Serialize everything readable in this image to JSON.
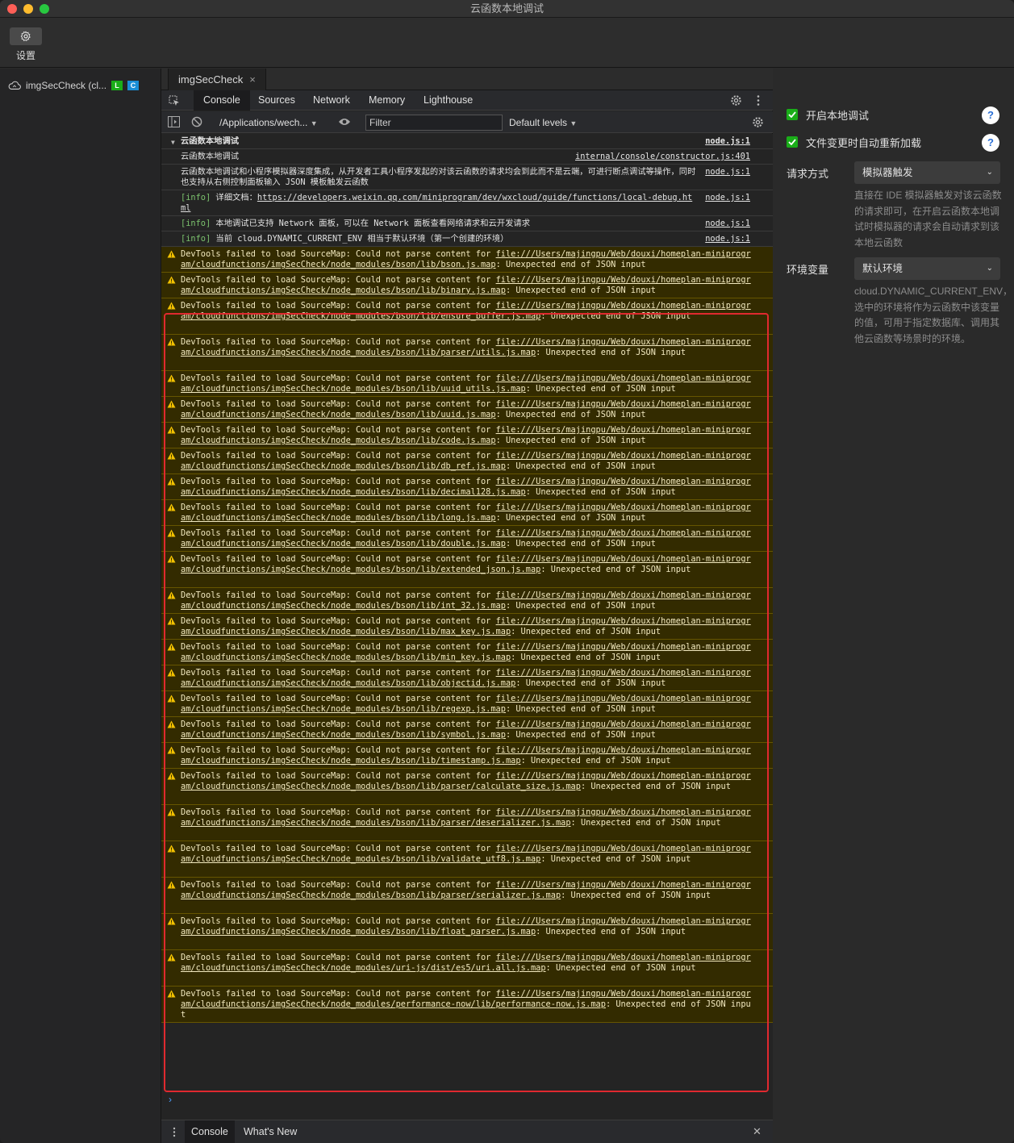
{
  "window": {
    "title": "云函数本地调试"
  },
  "toolbar": {
    "settings_label": "设置"
  },
  "sidebar": {
    "function_name": "imgSecCheck (cl...",
    "badge_l": "L",
    "badge_c": "C"
  },
  "file_tab": {
    "label": "imgSecCheck",
    "close": "×"
  },
  "devtools": {
    "tabs": [
      "Console",
      "Sources",
      "Network",
      "Memory",
      "Lighthouse"
    ],
    "context": "/Applications/wech...",
    "filter_placeholder": "Filter",
    "levels": "Default levels"
  },
  "console": {
    "group_title": "云函数本地调试",
    "group_src": "node.js:1",
    "messages": [
      {
        "text": "云函数本地调试",
        "src": "internal/console/constructor.js:401"
      },
      {
        "text": "云函数本地调试和小程序模拟器深度集成，从开发者工具小程序发起的对该云函数的请求均会到此而不是云端，可进行断点调试等操作，同时也支持从右侧控制面板输入 JSON 模板触发云函数",
        "src": "node.js:1"
      },
      {
        "tag": "[info]",
        "text": " 详细文档：",
        "link": "https://developers.weixin.qq.com/miniprogram/dev/wxcloud/guide/functions/local-debug.html",
        "src": "node.js:1"
      },
      {
        "tag": "[info]",
        "text": " 本地调试已支持 Network 面板，可以在 Network 面板查看网络请求和云开发请求",
        "src": "node.js:1"
      },
      {
        "tag": "[info]",
        "text": " 当前 cloud.DYNAMIC_CURRENT_ENV 相当于默认环境（第一个创建的环境）",
        "src": "node.js:1"
      }
    ],
    "warning_prefix": "DevTools failed to load SourceMap: Could not parse content for ",
    "warning_suffix": ": Unexpected end of JSON input",
    "warnings": [
      "file:///Users/majingpu/Web/douxi/homeplan-miniprogram/cloudfunctions/imgSecCheck/node_modules/bson/lib/bson.js.map",
      "file:///Users/majingpu/Web/douxi/homeplan-miniprogram/cloudfunctions/imgSecCheck/node_modules/bson/lib/binary.js.map",
      "file:///Users/majingpu/Web/douxi/homeplan-miniprogram/cloudfunctions/imgSecCheck/node_modules/bson/lib/ensure_buffer.js.map",
      "file:///Users/majingpu/Web/douxi/homeplan-miniprogram/cloudfunctions/imgSecCheck/node_modules/bson/lib/parser/utils.js.map",
      "file:///Users/majingpu/Web/douxi/homeplan-miniprogram/cloudfunctions/imgSecCheck/node_modules/bson/lib/uuid_utils.js.map",
      "file:///Users/majingpu/Web/douxi/homeplan-miniprogram/cloudfunctions/imgSecCheck/node_modules/bson/lib/uuid.js.map",
      "file:///Users/majingpu/Web/douxi/homeplan-miniprogram/cloudfunctions/imgSecCheck/node_modules/bson/lib/code.js.map",
      "file:///Users/majingpu/Web/douxi/homeplan-miniprogram/cloudfunctions/imgSecCheck/node_modules/bson/lib/db_ref.js.map",
      "file:///Users/majingpu/Web/douxi/homeplan-miniprogram/cloudfunctions/imgSecCheck/node_modules/bson/lib/decimal128.js.map",
      "file:///Users/majingpu/Web/douxi/homeplan-miniprogram/cloudfunctions/imgSecCheck/node_modules/bson/lib/long.js.map",
      "file:///Users/majingpu/Web/douxi/homeplan-miniprogram/cloudfunctions/imgSecCheck/node_modules/bson/lib/double.js.map",
      "file:///Users/majingpu/Web/douxi/homeplan-miniprogram/cloudfunctions/imgSecCheck/node_modules/bson/lib/extended_json.js.map",
      "file:///Users/majingpu/Web/douxi/homeplan-miniprogram/cloudfunctions/imgSecCheck/node_modules/bson/lib/int_32.js.map",
      "file:///Users/majingpu/Web/douxi/homeplan-miniprogram/cloudfunctions/imgSecCheck/node_modules/bson/lib/max_key.js.map",
      "file:///Users/majingpu/Web/douxi/homeplan-miniprogram/cloudfunctions/imgSecCheck/node_modules/bson/lib/min_key.js.map",
      "file:///Users/majingpu/Web/douxi/homeplan-miniprogram/cloudfunctions/imgSecCheck/node_modules/bson/lib/objectid.js.map",
      "file:///Users/majingpu/Web/douxi/homeplan-miniprogram/cloudfunctions/imgSecCheck/node_modules/bson/lib/regexp.js.map",
      "file:///Users/majingpu/Web/douxi/homeplan-miniprogram/cloudfunctions/imgSecCheck/node_modules/bson/lib/symbol.js.map",
      "file:///Users/majingpu/Web/douxi/homeplan-miniprogram/cloudfunctions/imgSecCheck/node_modules/bson/lib/timestamp.js.map",
      "file:///Users/majingpu/Web/douxi/homeplan-miniprogram/cloudfunctions/imgSecCheck/node_modules/bson/lib/parser/calculate_size.js.map",
      "file:///Users/majingpu/Web/douxi/homeplan-miniprogram/cloudfunctions/imgSecCheck/node_modules/bson/lib/parser/deserializer.js.map",
      "file:///Users/majingpu/Web/douxi/homeplan-miniprogram/cloudfunctions/imgSecCheck/node_modules/bson/lib/validate_utf8.js.map",
      "file:///Users/majingpu/Web/douxi/homeplan-miniprogram/cloudfunctions/imgSecCheck/node_modules/bson/lib/parser/serializer.js.map",
      "file:///Users/majingpu/Web/douxi/homeplan-miniprogram/cloudfunctions/imgSecCheck/node_modules/bson/lib/float_parser.js.map",
      "file:///Users/majingpu/Web/douxi/homeplan-miniprogram/cloudfunctions/imgSecCheck/node_modules/uri-js/dist/es5/uri.all.js.map",
      "file:///Users/majingpu/Web/douxi/homeplan-miniprogram/cloudfunctions/imgSecCheck/node_modules/performance-now/lib/performance-now.js.map"
    ],
    "prompt": "›"
  },
  "drawer": {
    "tabs": [
      "Console",
      "What's New"
    ],
    "close": "✕"
  },
  "settings_panel": {
    "enable_local_debug": "开启本地调试",
    "auto_reload": "文件变更时自动重新加载",
    "help": "?",
    "request_mode_label": "请求方式",
    "request_mode_value": "模拟器触发",
    "request_mode_desc": "直接在 IDE 模拟器触发对该云函数的请求即可，在开启云函数本地调试时模拟器的请求会自动请求到该本地云函数",
    "env_label": "环境变量",
    "env_value": "默认环境",
    "env_desc": "cloud.DYNAMIC_CURRENT_ENV，选中的环境将作为云函数中该变量的值，可用于指定数据库、调用其他云函数等场景时的环境。"
  },
  "colors": {
    "accent_green": "#1aad19",
    "highlight_red": "#e0292f",
    "warning_bg": "#332b00"
  }
}
